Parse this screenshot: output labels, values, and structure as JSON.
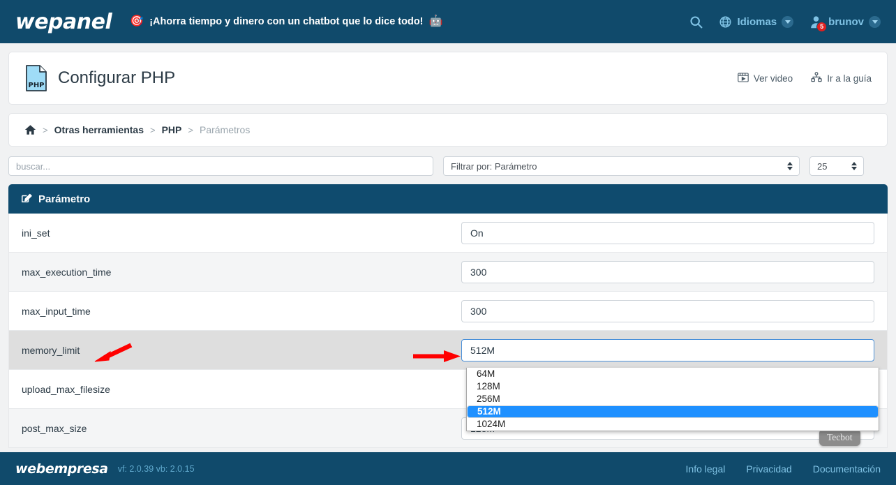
{
  "topbar": {
    "brand": "wepanel",
    "promo_emoji": "🎯",
    "promo_text": "¡Ahorra tiempo y dinero con un chatbot que lo dice todo!",
    "promo_emoji_end": "🤖",
    "search_icon": "search-icon",
    "languages_label": "Idiomas",
    "user_label": "brunov",
    "notification_count": "5"
  },
  "header": {
    "title": "Configurar PHP",
    "icon_label": "PHP",
    "video_link": "Ver video",
    "guide_link": "Ir a la guía"
  },
  "breadcrumb": {
    "home_icon": "home-icon",
    "items": [
      {
        "label": "Otras herramientas"
      },
      {
        "label": "PHP"
      },
      {
        "label": "Parámetros"
      }
    ],
    "separator": ">"
  },
  "filters": {
    "search_placeholder": "buscar...",
    "search_value": "",
    "filter_by": "Filtrar por: Parámetro",
    "page_size": "25"
  },
  "table": {
    "header_label": "Parámetro",
    "header_icon": "edit-icon",
    "rows": [
      {
        "name": "ini_set",
        "value": "On"
      },
      {
        "name": "max_execution_time",
        "value": "300"
      },
      {
        "name": "max_input_time",
        "value": "300"
      },
      {
        "name": "memory_limit",
        "value": "512M"
      },
      {
        "name": "upload_max_filesize",
        "value": ""
      },
      {
        "name": "post_max_size",
        "value": "128M"
      }
    ]
  },
  "dropdown": {
    "open_for": "memory_limit",
    "selected": "512M",
    "options": [
      "64M",
      "128M",
      "256M",
      "512M",
      "1024M"
    ]
  },
  "tecbot": {
    "label": "Tecbot"
  },
  "annotations": {
    "arrow_left": "red-arrow-pointing-to-memory-limit",
    "arrow_right": "red-arrow-pointing-to-memory-limit-select"
  },
  "footer": {
    "brand": "webempresa",
    "version": "vf: 2.0.39 vb: 2.0.15",
    "links": [
      {
        "label": "Info legal"
      },
      {
        "label": "Privacidad"
      },
      {
        "label": "Documentación"
      }
    ]
  },
  "colors": {
    "navy": "#104a6b",
    "table_header": "#0f4b6e",
    "accent_blue": "#7fc2e4",
    "highlight": "#1e90ff",
    "arrow_red": "#ff0000"
  }
}
